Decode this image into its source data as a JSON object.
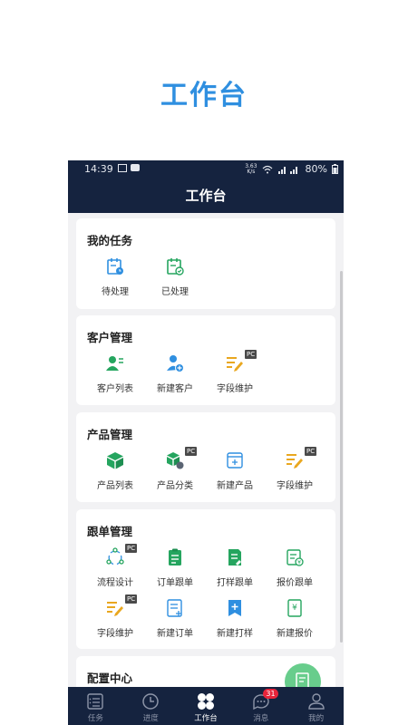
{
  "promo_title": "工作台",
  "status": {
    "time": "14:39",
    "speed_top": "3.63",
    "speed_bottom": "K/s",
    "battery": "80%"
  },
  "header": {
    "title": "工作台"
  },
  "sections": {
    "tasks": {
      "title": "我的任务",
      "items": [
        {
          "label": "待处理",
          "icon": "calendar-clock-icon"
        },
        {
          "label": "已处理",
          "icon": "calendar-check-icon"
        }
      ]
    },
    "customers": {
      "title": "客户管理",
      "items": [
        {
          "label": "客户列表",
          "icon": "user-list-icon"
        },
        {
          "label": "新建客户",
          "icon": "add-user-icon"
        },
        {
          "label": "字段维护",
          "icon": "field-edit-icon",
          "badge": "PC"
        }
      ]
    },
    "products": {
      "title": "产品管理",
      "items": [
        {
          "label": "产品列表",
          "icon": "cube-icon"
        },
        {
          "label": "产品分类",
          "icon": "category-icon",
          "badge": "PC"
        },
        {
          "label": "新建产品",
          "icon": "new-product-icon"
        },
        {
          "label": "字段维护",
          "icon": "field-edit-icon",
          "badge": "PC"
        }
      ]
    },
    "orders": {
      "title": "跟单管理",
      "items": [
        {
          "label": "流程设计",
          "icon": "flow-icon",
          "badge": "PC"
        },
        {
          "label": "订单跟单",
          "icon": "clipboard-icon"
        },
        {
          "label": "打样跟单",
          "icon": "sample-doc-icon"
        },
        {
          "label": "报价跟单",
          "icon": "quote-doc-icon"
        },
        {
          "label": "字段维护",
          "icon": "field-edit-icon",
          "badge": "PC"
        },
        {
          "label": "新建订单",
          "icon": "new-order-icon"
        },
        {
          "label": "新建打样",
          "icon": "new-sample-icon"
        },
        {
          "label": "新建报价",
          "icon": "new-quote-icon"
        }
      ]
    },
    "config": {
      "title": "配置中心"
    }
  },
  "tabs": [
    {
      "label": "任务"
    },
    {
      "label": "进度"
    },
    {
      "label": "工作台"
    },
    {
      "label": "消息",
      "badge": "31"
    },
    {
      "label": "我的"
    }
  ],
  "colors": {
    "navy": "#15233f",
    "green": "#25a55f",
    "blue": "#2f8fe0",
    "yellow": "#e9a71f",
    "promo": "#2f8fe0"
  }
}
